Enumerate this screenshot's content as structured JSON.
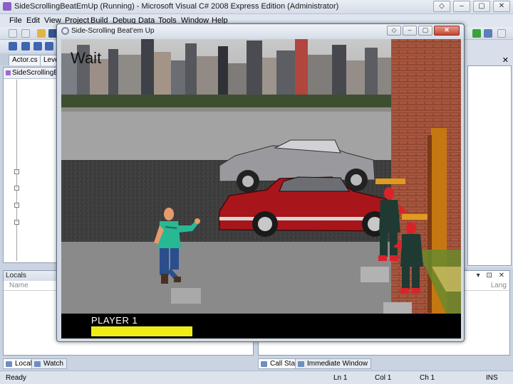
{
  "ide": {
    "title": "SideScrollingBeatEmUp (Running) - Microsoft Visual C# 2008 Express Edition (Administrator)",
    "window_buttons": [
      "◇",
      "–",
      "▢",
      "✕"
    ],
    "menu": [
      "File",
      "Edit",
      "View",
      "Project",
      "Build",
      "Debug",
      "Data",
      "Tools",
      "Window",
      "Help"
    ],
    "doc_tabs": [
      "Actor.cs",
      "Leve"
    ],
    "nav_bar_text": "SideScrollingBe",
    "locals_title": "Locals",
    "locals_column": "Name",
    "callstack_column": "Lang",
    "callstack_controls": "▾ ⊡ ✕",
    "right_panel_close": "✕",
    "bottom_tabs": [
      "Locals",
      "Watch",
      "Call Stack",
      "Immediate Window"
    ],
    "status": {
      "ready": "Ready",
      "line": "Ln 1",
      "col": "Col 1",
      "ch": "Ch 1",
      "mode": "INS"
    }
  },
  "game": {
    "window_title": "Side-Scrolling Beat'em Up",
    "window_buttons": [
      "◇",
      "–",
      "▢",
      "✕"
    ],
    "state_text": "Wait",
    "player_label": "PLAYER 1",
    "player_health_fraction": 1.0,
    "colors": {
      "health": "#f0ec17",
      "hud_bg": "#000000",
      "red_car": "#a8151b",
      "silver_car": "#9a9a9e",
      "player_shirt": "#29b894",
      "player_pants": "#2b4e8c",
      "enemy_skin": "#d8232a",
      "enemy_shirt": "#1f3a32",
      "brick": "#a8573f",
      "door": "#c57812",
      "enemy_health": "#e09b1e"
    }
  }
}
